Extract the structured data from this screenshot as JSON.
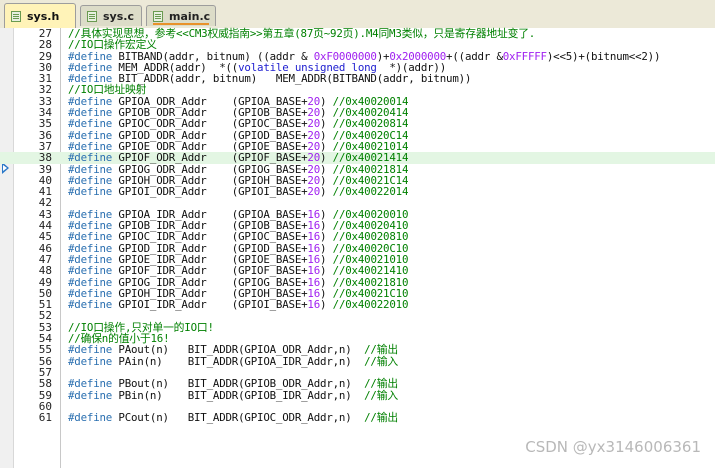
{
  "tabs": [
    {
      "label": "sys.h",
      "active": true
    },
    {
      "label": "sys.c",
      "active": false
    },
    {
      "label": "main.c",
      "active": false
    }
  ],
  "current_line": 38,
  "lines": [
    {
      "n": 27,
      "segs": [
        {
          "c": "cmt",
          "t": "//具体实现思想，参考<<CM3权威指南>>第五章(87页~92页).M4同M3类似，只是寄存器地址变了."
        }
      ]
    },
    {
      "n": 28,
      "segs": [
        {
          "c": "cmt",
          "t": "//IO口操作宏定义"
        }
      ]
    },
    {
      "n": 29,
      "segs": [
        {
          "c": "pp",
          "t": "#define "
        },
        {
          "c": "txt",
          "t": "BITBAND(addr, bitnum) ((addr & "
        },
        {
          "c": "num",
          "t": "0xF0000000"
        },
        {
          "c": "txt",
          "t": ")+"
        },
        {
          "c": "num",
          "t": "0x2000000"
        },
        {
          "c": "txt",
          "t": "+((addr &"
        },
        {
          "c": "num",
          "t": "0xFFFFF"
        },
        {
          "c": "txt",
          "t": ")<<5)+(bitnum<<2))"
        }
      ]
    },
    {
      "n": 30,
      "segs": [
        {
          "c": "pp",
          "t": "#define "
        },
        {
          "c": "txt",
          "t": "MEM_ADDR(addr)  *(("
        },
        {
          "c": "kw",
          "t": "volatile unsigned long"
        },
        {
          "c": "txt",
          "t": "  *)(addr))"
        }
      ]
    },
    {
      "n": 31,
      "segs": [
        {
          "c": "pp",
          "t": "#define "
        },
        {
          "c": "txt",
          "t": "BIT_ADDR(addr, bitnum)   MEM_ADDR(BITBAND(addr, bitnum))"
        }
      ]
    },
    {
      "n": 32,
      "segs": [
        {
          "c": "cmt",
          "t": "//IO口地址映射"
        }
      ]
    },
    {
      "n": 33,
      "segs": [
        {
          "c": "pp",
          "t": "#define "
        },
        {
          "c": "txt",
          "t": "GPIOA_ODR_Addr    (GPIOA_BASE+"
        },
        {
          "c": "num",
          "t": "20"
        },
        {
          "c": "txt",
          "t": ") "
        },
        {
          "c": "cmt",
          "t": "//0x40020014"
        }
      ]
    },
    {
      "n": 34,
      "segs": [
        {
          "c": "pp",
          "t": "#define "
        },
        {
          "c": "txt",
          "t": "GPIOB_ODR_Addr    (GPIOB_BASE+"
        },
        {
          "c": "num",
          "t": "20"
        },
        {
          "c": "txt",
          "t": ") "
        },
        {
          "c": "cmt",
          "t": "//0x40020414"
        }
      ]
    },
    {
      "n": 35,
      "segs": [
        {
          "c": "pp",
          "t": "#define "
        },
        {
          "c": "txt",
          "t": "GPIOC_ODR_Addr    (GPIOC_BASE+"
        },
        {
          "c": "num",
          "t": "20"
        },
        {
          "c": "txt",
          "t": ") "
        },
        {
          "c": "cmt",
          "t": "//0x40020814"
        }
      ]
    },
    {
      "n": 36,
      "segs": [
        {
          "c": "pp",
          "t": "#define "
        },
        {
          "c": "txt",
          "t": "GPIOD_ODR_Addr    (GPIOD_BASE+"
        },
        {
          "c": "num",
          "t": "20"
        },
        {
          "c": "txt",
          "t": ") "
        },
        {
          "c": "cmt",
          "t": "//0x40020C14"
        }
      ]
    },
    {
      "n": 37,
      "segs": [
        {
          "c": "pp",
          "t": "#define "
        },
        {
          "c": "txt",
          "t": "GPIOE_ODR_Addr    (GPIOE_BASE+"
        },
        {
          "c": "num",
          "t": "20"
        },
        {
          "c": "txt",
          "t": ") "
        },
        {
          "c": "cmt",
          "t": "//0x40021014"
        }
      ]
    },
    {
      "n": 38,
      "segs": [
        {
          "c": "pp",
          "t": "#define "
        },
        {
          "c": "txt",
          "t": "GPIOF_ODR_Addr    (GPIOF_BASE+"
        },
        {
          "c": "num",
          "t": "20"
        },
        {
          "c": "txt",
          "t": ") "
        },
        {
          "c": "cmt",
          "t": "//0x40021414"
        }
      ]
    },
    {
      "n": 39,
      "segs": [
        {
          "c": "pp",
          "t": "#define "
        },
        {
          "c": "txt",
          "t": "GPIOG_ODR_Addr    (GPIOG_BASE+"
        },
        {
          "c": "num",
          "t": "20"
        },
        {
          "c": "txt",
          "t": ") "
        },
        {
          "c": "cmt",
          "t": "//0x40021814"
        }
      ]
    },
    {
      "n": 40,
      "segs": [
        {
          "c": "pp",
          "t": "#define "
        },
        {
          "c": "txt",
          "t": "GPIOH_ODR_Addr    (GPIOH_BASE+"
        },
        {
          "c": "num",
          "t": "20"
        },
        {
          "c": "txt",
          "t": ") "
        },
        {
          "c": "cmt",
          "t": "//0x40021C14"
        }
      ]
    },
    {
      "n": 41,
      "segs": [
        {
          "c": "pp",
          "t": "#define "
        },
        {
          "c": "txt",
          "t": "GPIOI_ODR_Addr    (GPIOI_BASE+"
        },
        {
          "c": "num",
          "t": "20"
        },
        {
          "c": "txt",
          "t": ") "
        },
        {
          "c": "cmt",
          "t": "//0x40022014"
        }
      ]
    },
    {
      "n": 42,
      "segs": []
    },
    {
      "n": 43,
      "segs": [
        {
          "c": "pp",
          "t": "#define "
        },
        {
          "c": "txt",
          "t": "GPIOA_IDR_Addr    (GPIOA_BASE+"
        },
        {
          "c": "num",
          "t": "16"
        },
        {
          "c": "txt",
          "t": ") "
        },
        {
          "c": "cmt",
          "t": "//0x40020010"
        }
      ]
    },
    {
      "n": 44,
      "segs": [
        {
          "c": "pp",
          "t": "#define "
        },
        {
          "c": "txt",
          "t": "GPIOB_IDR_Addr    (GPIOB_BASE+"
        },
        {
          "c": "num",
          "t": "16"
        },
        {
          "c": "txt",
          "t": ") "
        },
        {
          "c": "cmt",
          "t": "//0x40020410"
        }
      ]
    },
    {
      "n": 45,
      "segs": [
        {
          "c": "pp",
          "t": "#define "
        },
        {
          "c": "txt",
          "t": "GPIOC_IDR_Addr    (GPIOC_BASE+"
        },
        {
          "c": "num",
          "t": "16"
        },
        {
          "c": "txt",
          "t": ") "
        },
        {
          "c": "cmt",
          "t": "//0x40020810"
        }
      ]
    },
    {
      "n": 46,
      "segs": [
        {
          "c": "pp",
          "t": "#define "
        },
        {
          "c": "txt",
          "t": "GPIOD_IDR_Addr    (GPIOD_BASE+"
        },
        {
          "c": "num",
          "t": "16"
        },
        {
          "c": "txt",
          "t": ") "
        },
        {
          "c": "cmt",
          "t": "//0x40020C10"
        }
      ]
    },
    {
      "n": 47,
      "segs": [
        {
          "c": "pp",
          "t": "#define "
        },
        {
          "c": "txt",
          "t": "GPIOE_IDR_Addr    (GPIOE_BASE+"
        },
        {
          "c": "num",
          "t": "16"
        },
        {
          "c": "txt",
          "t": ") "
        },
        {
          "c": "cmt",
          "t": "//0x40021010"
        }
      ]
    },
    {
      "n": 48,
      "segs": [
        {
          "c": "pp",
          "t": "#define "
        },
        {
          "c": "txt",
          "t": "GPIOF_IDR_Addr    (GPIOF_BASE+"
        },
        {
          "c": "num",
          "t": "16"
        },
        {
          "c": "txt",
          "t": ") "
        },
        {
          "c": "cmt",
          "t": "//0x40021410"
        }
      ]
    },
    {
      "n": 49,
      "segs": [
        {
          "c": "pp",
          "t": "#define "
        },
        {
          "c": "txt",
          "t": "GPIOG_IDR_Addr    (GPIOG_BASE+"
        },
        {
          "c": "num",
          "t": "16"
        },
        {
          "c": "txt",
          "t": ") "
        },
        {
          "c": "cmt",
          "t": "//0x40021810"
        }
      ]
    },
    {
      "n": 50,
      "segs": [
        {
          "c": "pp",
          "t": "#define "
        },
        {
          "c": "txt",
          "t": "GPIOH_IDR_Addr    (GPIOH_BASE+"
        },
        {
          "c": "num",
          "t": "16"
        },
        {
          "c": "txt",
          "t": ") "
        },
        {
          "c": "cmt",
          "t": "//0x40021C10"
        }
      ]
    },
    {
      "n": 51,
      "segs": [
        {
          "c": "pp",
          "t": "#define "
        },
        {
          "c": "txt",
          "t": "GPIOI_IDR_Addr    (GPIOI_BASE+"
        },
        {
          "c": "num",
          "t": "16"
        },
        {
          "c": "txt",
          "t": ") "
        },
        {
          "c": "cmt",
          "t": "//0x40022010"
        }
      ]
    },
    {
      "n": 52,
      "segs": []
    },
    {
      "n": 53,
      "segs": [
        {
          "c": "cmt",
          "t": "//IO口操作,只对单一的IO口!"
        }
      ]
    },
    {
      "n": 54,
      "segs": [
        {
          "c": "cmt",
          "t": "//确保n的值小于16!"
        }
      ]
    },
    {
      "n": 55,
      "segs": [
        {
          "c": "pp",
          "t": "#define "
        },
        {
          "c": "txt",
          "t": "PAout(n)   BIT_ADDR(GPIOA_ODR_Addr,n)  "
        },
        {
          "c": "cmt",
          "t": "//输出"
        }
      ]
    },
    {
      "n": 56,
      "segs": [
        {
          "c": "pp",
          "t": "#define "
        },
        {
          "c": "txt",
          "t": "PAin(n)    BIT_ADDR(GPIOA_IDR_Addr,n)  "
        },
        {
          "c": "cmt",
          "t": "//输入"
        }
      ]
    },
    {
      "n": 57,
      "segs": []
    },
    {
      "n": 58,
      "segs": [
        {
          "c": "pp",
          "t": "#define "
        },
        {
          "c": "txt",
          "t": "PBout(n)   BIT_ADDR(GPIOB_ODR_Addr,n)  "
        },
        {
          "c": "cmt",
          "t": "//输出"
        }
      ]
    },
    {
      "n": 59,
      "segs": [
        {
          "c": "pp",
          "t": "#define "
        },
        {
          "c": "txt",
          "t": "PBin(n)    BIT_ADDR(GPIOB_IDR_Addr,n)  "
        },
        {
          "c": "cmt",
          "t": "//输入"
        }
      ]
    },
    {
      "n": 60,
      "segs": []
    },
    {
      "n": 61,
      "segs": [
        {
          "c": "pp",
          "t": "#define "
        },
        {
          "c": "txt",
          "t": "PCout(n)   BIT_ADDR(GPIOC_ODR_Addr,n)  "
        },
        {
          "c": "cmt",
          "t": "//输出"
        }
      ]
    }
  ],
  "watermark": "CSDN @yx3146006361"
}
